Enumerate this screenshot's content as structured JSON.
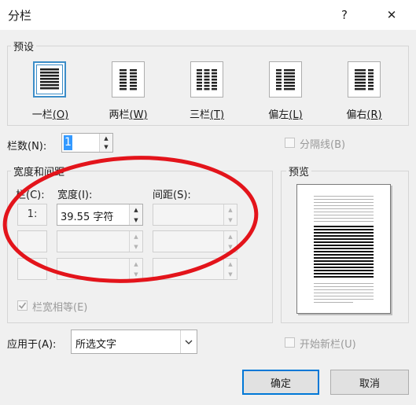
{
  "dialog": {
    "title": "分栏",
    "help_label": "?",
    "close_label": "✕"
  },
  "presets": {
    "group_label": "预设",
    "items": [
      {
        "label": "一栏",
        "key": "O",
        "selected": true,
        "icon": "one-column-icon"
      },
      {
        "label": "两栏",
        "key": "W",
        "selected": false,
        "icon": "two-columns-icon"
      },
      {
        "label": "三栏",
        "key": "T",
        "selected": false,
        "icon": "three-columns-icon"
      },
      {
        "label": "偏左",
        "key": "L",
        "selected": false,
        "icon": "left-columns-icon"
      },
      {
        "label": "偏右",
        "key": "R",
        "selected": false,
        "icon": "right-columns-icon"
      }
    ]
  },
  "columns_count": {
    "label": "栏数(N):",
    "value": "1"
  },
  "divider_line": {
    "label": "分隔线(B)",
    "checked": false,
    "enabled": false
  },
  "width_spacing": {
    "group_label": "宽度和间距",
    "col_header": "栏(C):",
    "width_header": "宽度(I):",
    "spacing_header": "间距(S):",
    "rows": [
      {
        "col": "1:",
        "width": "39.55 字符",
        "spacing": ""
      },
      {
        "col": "",
        "width": "",
        "spacing": ""
      },
      {
        "col": "",
        "width": "",
        "spacing": ""
      }
    ],
    "equal_width_label": "栏宽相等(E)",
    "equal_width_checked": true
  },
  "preview": {
    "group_label": "预览"
  },
  "apply_to": {
    "label": "应用于(A):",
    "value": "所选文字"
  },
  "new_column": {
    "label": "开始新栏(U)",
    "checked": false,
    "enabled": false
  },
  "buttons": {
    "ok": "确定",
    "cancel": "取消"
  },
  "annotation": {
    "color": "#e3141b"
  }
}
